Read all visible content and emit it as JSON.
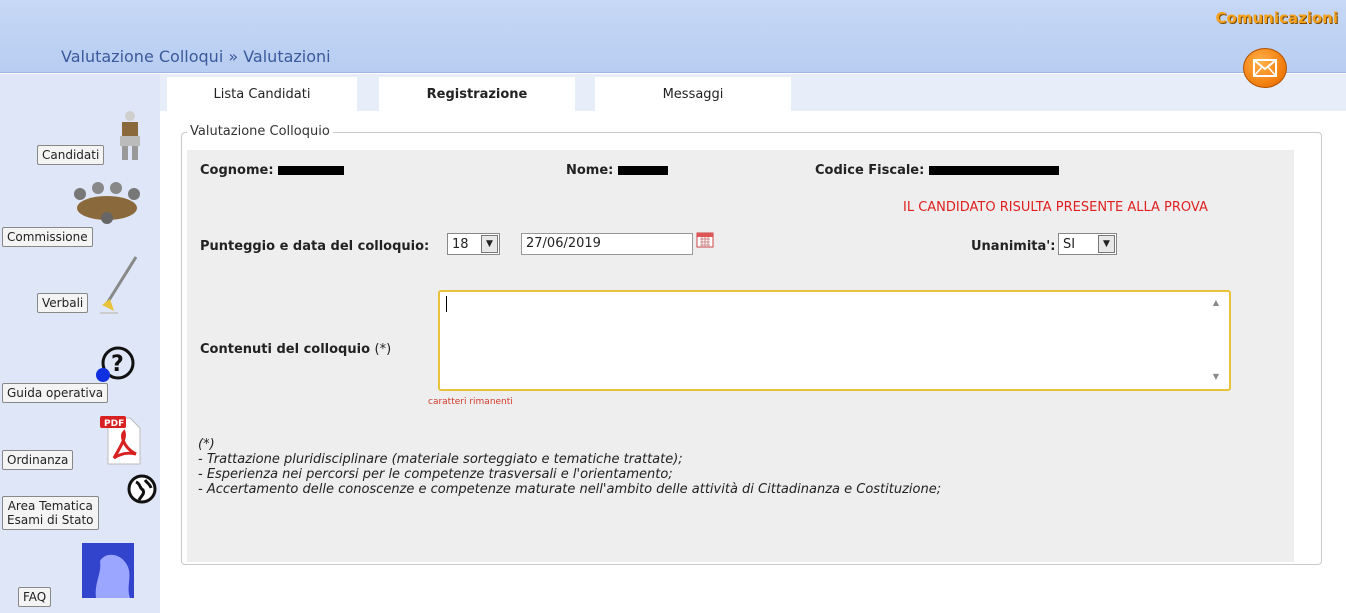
{
  "header": {
    "breadcrumb": "Valutazione Colloqui » Valutazioni",
    "communications_label": "Comunicazioni",
    "mail_icon": "envelope-icon"
  },
  "sidebar": {
    "items": [
      {
        "label": "Candidati",
        "icon": "candidate-figure-icon"
      },
      {
        "label": "Commissione",
        "icon": "commission-meeting-icon"
      },
      {
        "label": "Verbali",
        "icon": "pen-writing-icon"
      },
      {
        "label": "Guida operativa",
        "icon": "help-question-icon"
      },
      {
        "label": "Ordinanza",
        "icon": "pdf-icon"
      },
      {
        "label": "Area Tematica",
        "label2": "Esami di Stato",
        "icon": "globe-icon"
      },
      {
        "label": "FAQ",
        "icon": "face-profile-icon"
      }
    ]
  },
  "tabs": [
    {
      "label": "Lista Candidati",
      "active": false
    },
    {
      "label": "Registrazione",
      "active": true
    },
    {
      "label": "Messaggi",
      "active": false
    }
  ],
  "form": {
    "legend": "Valutazione Colloquio",
    "surname_label": "Cognome:",
    "name_label": "Nome:",
    "tax_code_label": "Codice Fiscale:",
    "presence_message": "IL CANDIDATO RISULTA PRESENTE ALLA PROVA",
    "score_label": "Punteggio e data del colloquio:",
    "score_value": "18",
    "date_value": "27/06/2019",
    "unanimity_label": "Unanimita':",
    "unanimity_value": "SI",
    "contents_label": "Contenuti del colloquio",
    "required_mark": "(*)",
    "remaining_chars": "caratteri rimanenti"
  },
  "notes": {
    "marker": "(*)",
    "lines": [
      "- Trattazione pluridisciplinare (materiale sorteggiato e tematiche trattate);",
      "- Esperienza nei percorsi per le competenze trasversali e l'orientamento;",
      "- Accertamento delle conoscenze e competenze maturate nell'ambito delle attività di Cittadinanza e Costituzione;"
    ]
  },
  "colors": {
    "header_bg": "#c6d8f5",
    "sidebar_bg": "#dfe6f7",
    "accent_orange": "#f5a21c",
    "alert_red": "#e02020",
    "textarea_border": "#e8c23a"
  }
}
